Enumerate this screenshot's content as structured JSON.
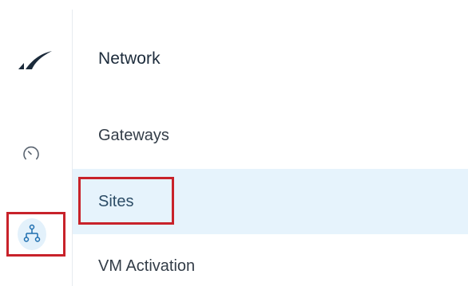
{
  "rail": {
    "logo_icon": "barracuda-logo-icon",
    "dashboard_icon": "speedometer-icon",
    "network_icon": "network-tree-icon",
    "accent_color": "#c8222a",
    "selected_bg": "#e3f1fb"
  },
  "panel": {
    "title": "Network",
    "items": [
      {
        "label": "Gateways",
        "selected": false
      },
      {
        "label": "Sites",
        "selected": true
      },
      {
        "label": "VM Activation",
        "selected": false
      }
    ],
    "selected_bg": "#e6f3fc"
  }
}
